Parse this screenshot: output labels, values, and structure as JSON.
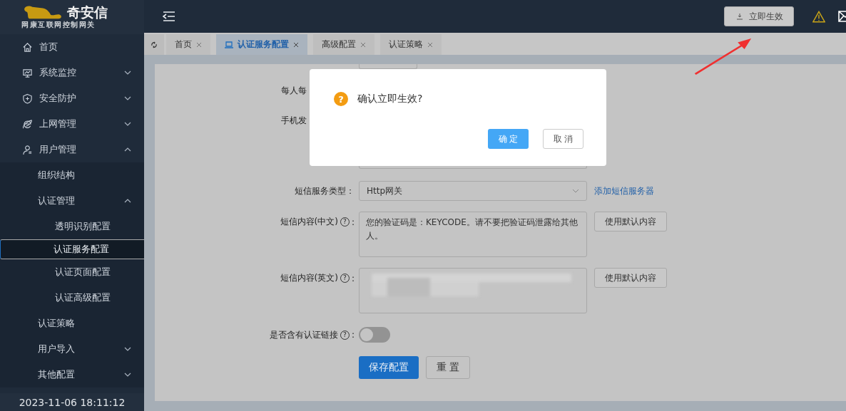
{
  "logo": {
    "brand": "奇安信",
    "subtitle": "网康互联网控制网关"
  },
  "header": {
    "apply_button": "立即生效"
  },
  "sidebar": {
    "items": [
      {
        "label": "首页",
        "kind": "home",
        "selected": false
      },
      {
        "label": "系统监控",
        "kind": "monitor",
        "selected": false,
        "expanded": false
      },
      {
        "label": "安全防护",
        "kind": "shield",
        "selected": false,
        "expanded": false
      },
      {
        "label": "上网管理",
        "kind": "browser",
        "selected": false,
        "expanded": false
      },
      {
        "label": "用户管理",
        "kind": "user",
        "selected": false,
        "expanded": true,
        "children": [
          {
            "label": "组织结构",
            "selected": false
          },
          {
            "label": "认证管理",
            "selected": false,
            "expanded": true,
            "children": [
              {
                "label": "透明识别配置",
                "selected": false
              },
              {
                "label": "认证服务配置",
                "selected": true
              },
              {
                "label": "认证页面配置",
                "selected": false
              },
              {
                "label": "认证高级配置",
                "selected": false
              }
            ]
          },
          {
            "label": "认证策略",
            "selected": false
          },
          {
            "label": "用户导入",
            "selected": false,
            "expanded": false
          },
          {
            "label": "其他配置",
            "selected": false,
            "expanded": false
          }
        ]
      }
    ]
  },
  "datetime": "2023-11-06 18:11:12",
  "tabs": [
    {
      "label": "首页",
      "selected": false
    },
    {
      "label": "认证服务配置",
      "selected": true
    },
    {
      "label": "高级配置",
      "selected": false
    },
    {
      "label": "认证策略",
      "selected": false
    }
  ],
  "form": {
    "rows": [
      {
        "kind": "stub"
      },
      {
        "kind": "partial",
        "label": "每人每"
      },
      {
        "kind": "partial",
        "label": "手机发"
      },
      {
        "kind": "textarea-tail"
      },
      {
        "kind": "select",
        "label": "短信服务类型：",
        "value": "Http网关",
        "link": "添加短信服务器"
      },
      {
        "kind": "textarea",
        "label": "短信内容(中文)",
        "help": "?",
        "colon": ":",
        "value": "您的验证码是：KEYCODE。请不要把验证码泄露给其他人。",
        "button": "使用默认内容"
      },
      {
        "kind": "textarea",
        "label": "短信内容(英文)",
        "help": "?",
        "colon": ":",
        "redacted": true,
        "button": "使用默认内容"
      },
      {
        "kind": "toggle",
        "label": "是否含有认证链接",
        "help": "?",
        "colon": ":",
        "on": false
      }
    ],
    "save_button": "保存配置",
    "reset_button": "重 置"
  },
  "dialog": {
    "icon": "?",
    "message": "确认立即生效?",
    "confirm": "确 定",
    "cancel": "取 消"
  }
}
